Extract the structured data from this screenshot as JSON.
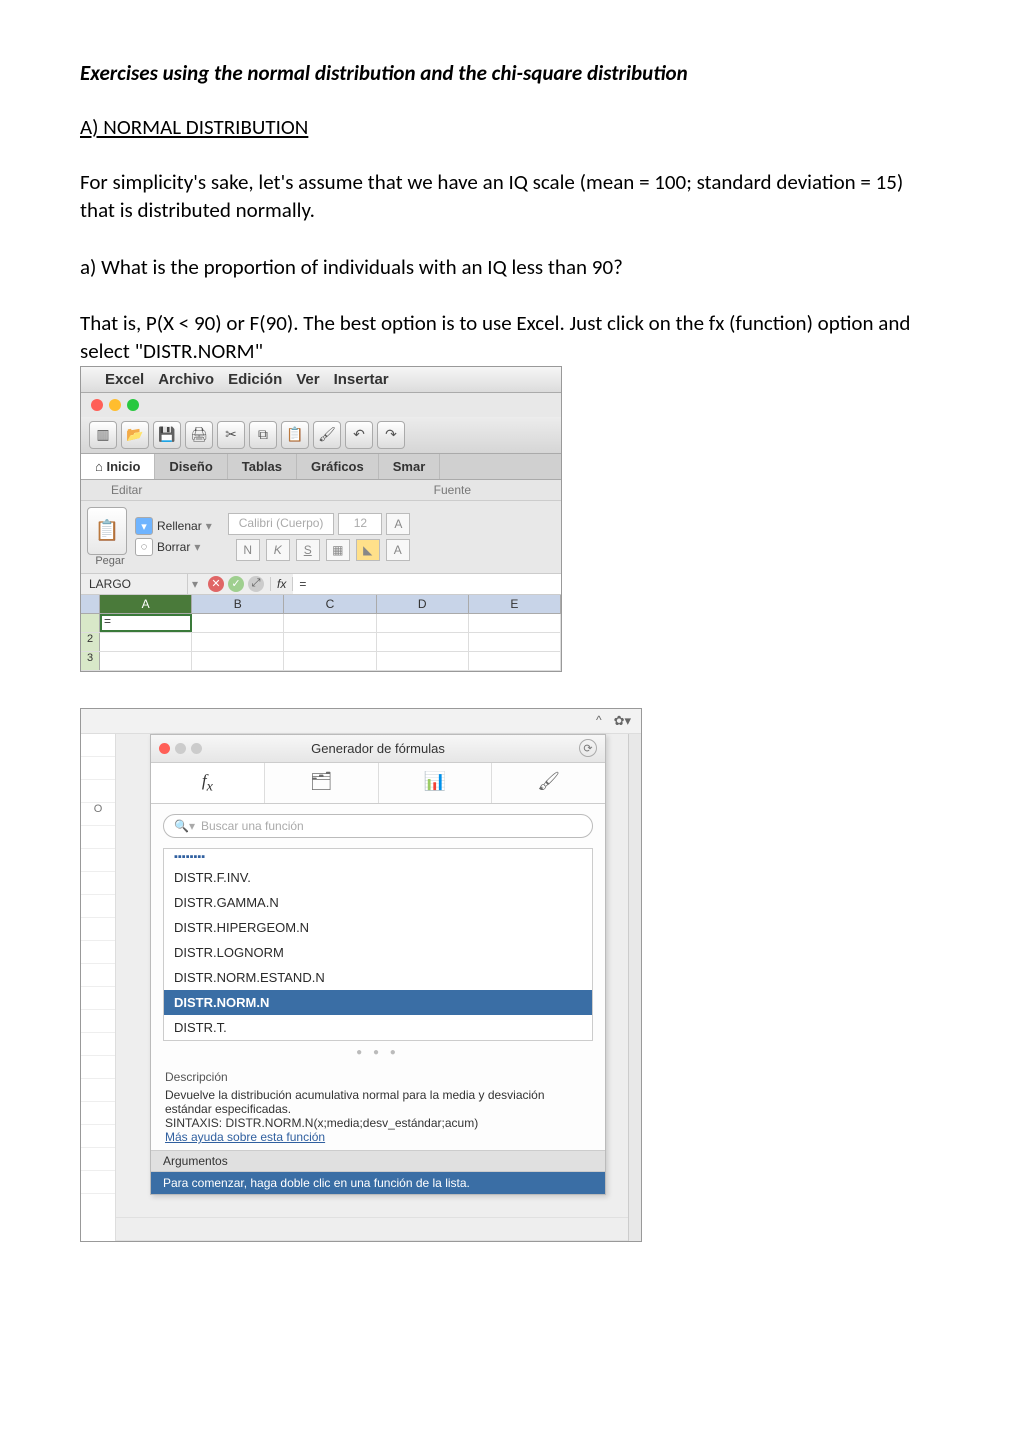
{
  "doc": {
    "title": "Exercises using the normal distribution and the chi-square distribution",
    "section_a": "A) NORMAL DISTRIBUTION",
    "p1": "For simplicity's sake, let's assume that we have an IQ scale (mean = 100; standard deviation = 15) that is distributed normally.",
    "p2": "a) What is the proportion of individuals with an IQ less than 90?",
    "p3": "That is, P(X < 90) or F(90). The best option is to use Excel. Just click on the fx (function) option and select \"DISTR.NORM\""
  },
  "shot1": {
    "menu": {
      "apple": "",
      "excel": "Excel",
      "archivo": "Archivo",
      "edicion": "Edición",
      "ver": "Ver",
      "insertar": "Insertar"
    },
    "tabs": {
      "inicio": "Inicio",
      "diseno": "Diseño",
      "tablas": "Tablas",
      "graficos": "Gráficos",
      "smar": "Smar"
    },
    "subtabs": {
      "editar": "Editar",
      "fuente": "Fuente"
    },
    "paste": {
      "pegar": "Pegar",
      "rellenar": "Rellenar",
      "borrar": "Borrar"
    },
    "font": {
      "name": "Calibri (Cuerpo)",
      "size": "12"
    },
    "fmt": {
      "n": "N",
      "k": "K",
      "s": "S"
    },
    "namebox": "LARGO",
    "fx_label": "fx",
    "fx_value": "=",
    "cols": {
      "a": "A",
      "b": "B",
      "c": "C",
      "d": "D",
      "e": "E"
    },
    "cellA1": "="
  },
  "shot2": {
    "toolbar_chevron": "^",
    "title": "Generador de fórmulas",
    "search_placeholder": "Buscar una función",
    "list": {
      "small_top": "",
      "items": [
        "DISTR.F.INV.",
        "DISTR.GAMMA.N",
        "DISTR.HIPERGEOM.N",
        "DISTR.LOGNORM",
        "DISTR.NORM.ESTAND.N",
        "DISTR.NORM.N",
        "DISTR.T."
      ],
      "selected_index": 5
    },
    "desc": {
      "hd": "Descripción",
      "body": "Devuelve la distribución acumulativa normal para la media y desviación estándar especificadas.",
      "syntax": "SINTAXIS:   DISTR.NORM.N(x;media;desv_estándar;acum)",
      "link": "Más ayuda sobre esta función"
    },
    "args": {
      "hd": "Argumentos",
      "msg": "Para comenzar, haga doble clic en una función de la lista."
    },
    "leftcell": "O"
  }
}
